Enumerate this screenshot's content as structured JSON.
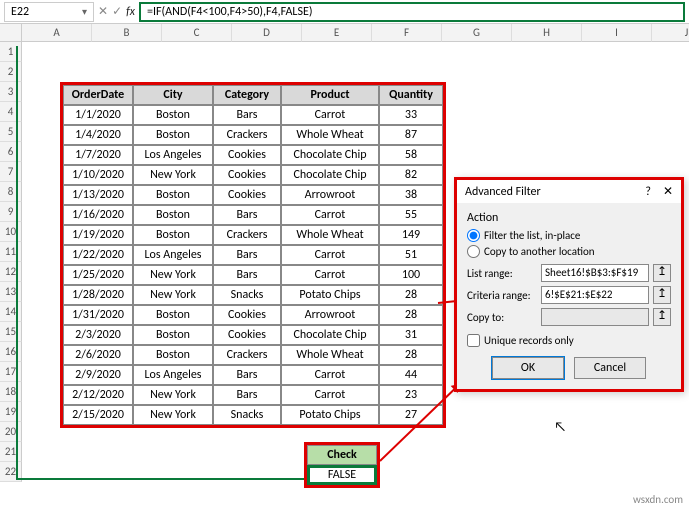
{
  "formulaBar": {
    "cellRef": "E22",
    "formula": "=IF(AND(F4<100,F4>50),F4,FALSE)"
  },
  "columns": [
    "A",
    "B",
    "C",
    "D",
    "E",
    "F",
    "G",
    "H",
    "I",
    "J"
  ],
  "rowCount": 22,
  "table": {
    "headers": [
      "OrderDate",
      "City",
      "Category",
      "Product",
      "Quantity"
    ],
    "rows": [
      [
        "1/1/2020",
        "Boston",
        "Bars",
        "Carrot",
        "33"
      ],
      [
        "1/4/2020",
        "Boston",
        "Crackers",
        "Whole Wheat",
        "87"
      ],
      [
        "1/7/2020",
        "Los Angeles",
        "Cookies",
        "Chocolate Chip",
        "58"
      ],
      [
        "1/10/2020",
        "New York",
        "Cookies",
        "Chocolate Chip",
        "82"
      ],
      [
        "1/13/2020",
        "Boston",
        "Cookies",
        "Arrowroot",
        "38"
      ],
      [
        "1/16/2020",
        "Boston",
        "Bars",
        "Carrot",
        "55"
      ],
      [
        "1/19/2020",
        "Boston",
        "Crackers",
        "Whole Wheat",
        "149"
      ],
      [
        "1/22/2020",
        "Los Angeles",
        "Bars",
        "Carrot",
        "51"
      ],
      [
        "1/25/2020",
        "New York",
        "Bars",
        "Carrot",
        "100"
      ],
      [
        "1/28/2020",
        "New York",
        "Snacks",
        "Potato Chips",
        "28"
      ],
      [
        "1/31/2020",
        "Boston",
        "Cookies",
        "Arrowroot",
        "28"
      ],
      [
        "2/3/2020",
        "Boston",
        "Cookies",
        "Chocolate Chip",
        "31"
      ],
      [
        "2/6/2020",
        "Boston",
        "Crackers",
        "Whole Wheat",
        "28"
      ],
      [
        "2/9/2020",
        "Los Angeles",
        "Bars",
        "Carrot",
        "44"
      ],
      [
        "2/12/2020",
        "New York",
        "Bars",
        "Carrot",
        "23"
      ],
      [
        "2/15/2020",
        "New York",
        "Snacks",
        "Potato Chips",
        "27"
      ]
    ]
  },
  "check": {
    "header": "Check",
    "value": "FALSE"
  },
  "dialog": {
    "title": "Advanced Filter",
    "section": "Action",
    "radio1": "Filter the list, in-place",
    "radio2": "Copy to another location",
    "listRangeLabel": "List range:",
    "listRange": "Sheet16!$B$3:$F$19",
    "criteriaLabel": "Criteria range:",
    "criteriaRange": "6!$E$21:$E$22",
    "copyToLabel": "Copy to:",
    "copyTo": "",
    "uniqueLabel": "Unique records only",
    "ok": "OK",
    "cancel": "Cancel"
  },
  "watermark": "wsxdn.com"
}
